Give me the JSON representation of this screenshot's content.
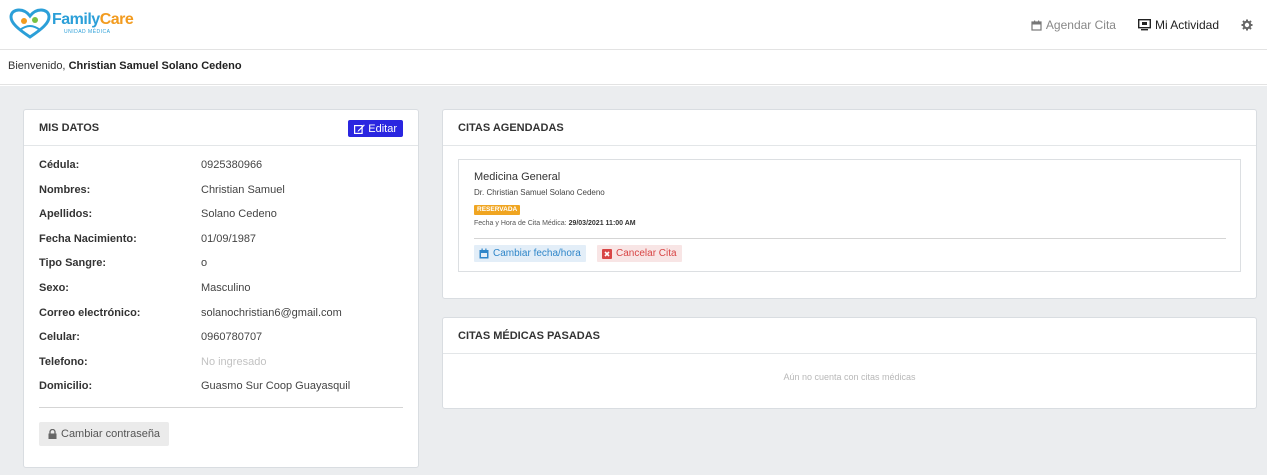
{
  "brand": {
    "name_part1": "Family",
    "name_part2": "Care",
    "subtitle": "UNIDAD MÉDICA",
    "logo_icon": "heart-hands-logo"
  },
  "nav": {
    "agendar_label": "Agendar Cita",
    "agendar_icon": "calendar-icon",
    "actividad_label": "Mi Actividad",
    "actividad_icon": "monitor-icon",
    "settings_icon": "gear-icon"
  },
  "welcome": {
    "prefix": "Bienvenido,",
    "user_name": "Christian Samuel Solano Cedeno"
  },
  "mis_datos": {
    "title": "MIS DATOS",
    "edit_label": "Editar",
    "rows": [
      {
        "label": "Cédula:",
        "value": "0925380966"
      },
      {
        "label": "Nombres:",
        "value": "Christian Samuel"
      },
      {
        "label": "Apellidos:",
        "value": "Solano Cedeno"
      },
      {
        "label": "Fecha Nacimiento:",
        "value": "01/09/1987"
      },
      {
        "label": "Tipo Sangre:",
        "value": "o"
      },
      {
        "label": "Sexo:",
        "value": "Masculino"
      },
      {
        "label": "Correo electrónico:",
        "value": "solanochristian6@gmail.com"
      },
      {
        "label": "Celular:",
        "value": "0960780707"
      },
      {
        "label": "Telefono:",
        "value": "No ingresado"
      },
      {
        "label": "Domicilio:",
        "value": "Guasmo Sur Coop Guayasquil"
      }
    ],
    "change_password_label": "Cambiar contraseña"
  },
  "citas_agendadas": {
    "title": "CITAS AGENDADAS",
    "items": [
      {
        "specialty": "Medicina General",
        "doctor": "Dr. Christian Samuel Solano Cedeno",
        "status": "RESERVADA",
        "date_label": "Fecha y Hora de Cita Médica:",
        "date_value": "29/03/2021 11:00 AM",
        "change_label": "Cambiar fecha/hora",
        "cancel_label": "Cancelar Cita"
      }
    ]
  },
  "citas_pasadas": {
    "title": "CITAS MÉDICAS PASADAS",
    "empty_message": "Aún no cuenta con citas médicas"
  },
  "colors": {
    "primary": "#2a26e0",
    "status_reserved": "#f0a521",
    "link_blue": "#2f86c9",
    "danger": "#d84545",
    "background": "#ebedef"
  }
}
